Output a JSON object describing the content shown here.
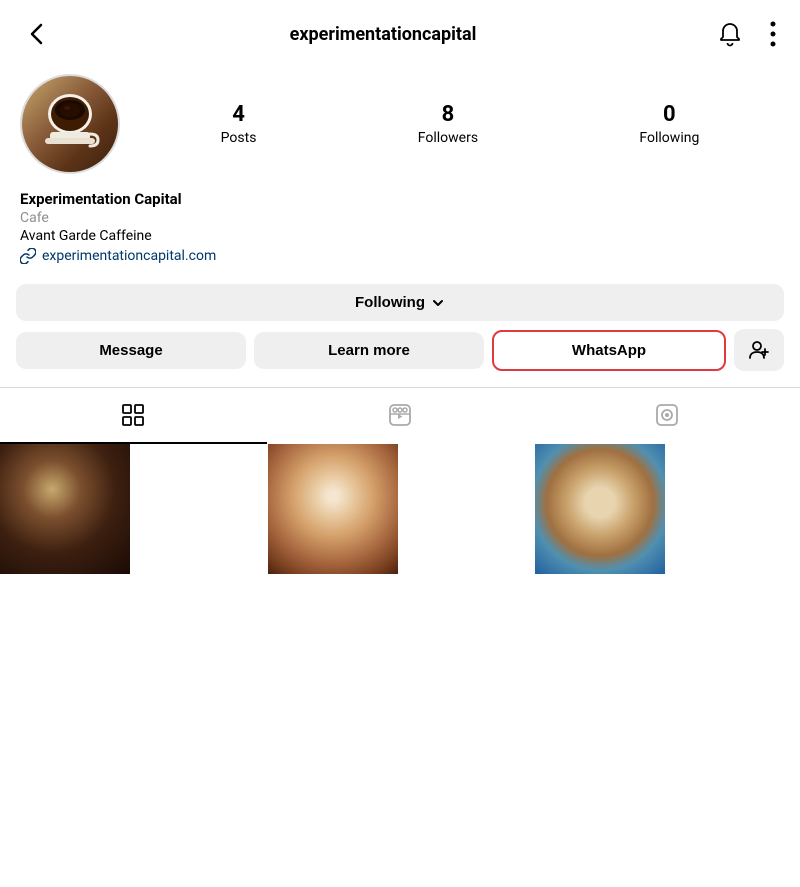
{
  "header": {
    "username": "experimentationcapital",
    "back_label": "←",
    "notification_icon": "bell-icon",
    "more_icon": "more-vertical-icon"
  },
  "profile": {
    "display_name": "Experimentation Capital",
    "category": "Cafe",
    "tagline": "Avant Garde Caffeine",
    "website_url": "experimentationcapital.com",
    "website_display": "experimentationcapital.com",
    "stats": {
      "posts_count": "4",
      "posts_label": "Posts",
      "followers_count": "8",
      "followers_label": "Followers",
      "following_count": "0",
      "following_label": "Following"
    }
  },
  "buttons": {
    "following_label": "Following",
    "message_label": "Message",
    "learn_more_label": "Learn more",
    "whatsapp_label": "WhatsApp",
    "add_friend_label": "+👤"
  },
  "tabs": {
    "grid_tab": "Grid",
    "reels_tab": "Reels",
    "tagged_tab": "Tagged"
  },
  "colors": {
    "whatsapp_border": "#e0393e",
    "link_color": "#00376b",
    "active_tab_border": "#000000",
    "button_bg": "#efefef"
  }
}
